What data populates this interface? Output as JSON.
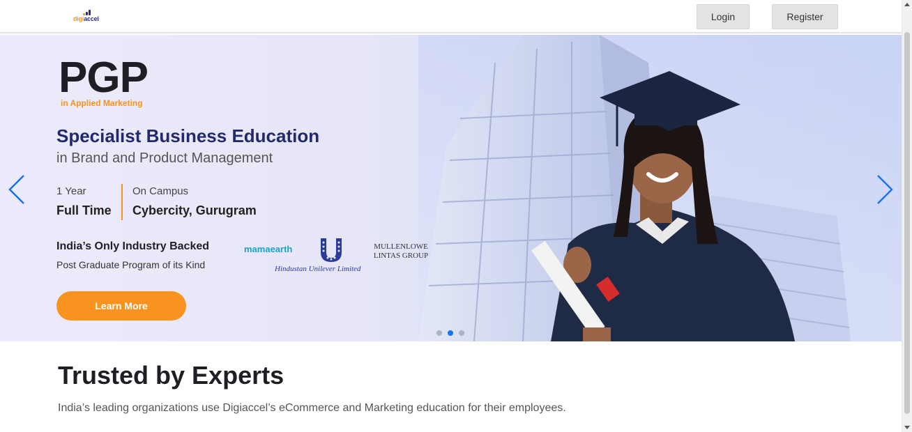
{
  "header": {
    "logo_text_a": "digi",
    "logo_text_b": "accel",
    "login_label": "Login",
    "register_label": "Register"
  },
  "hero": {
    "program": "PGP",
    "program_sub": "in Applied Marketing",
    "headline": "Specialist Business Education",
    "subheadline": "in Brand and Product Management",
    "duration_label": "1 Year",
    "duration_value": "Full Time",
    "location_label": "On Campus",
    "location_value": "Cybercity, Gurugram",
    "backed_title": "India’s Only Industry Backed",
    "backed_sub": "Post Graduate Program of its Kind",
    "brands": {
      "mamaearth": "mamaearth",
      "hul": "Hindustan Unilever Limited",
      "ml_line1": "MULLENLOWE",
      "ml_line2": "LINTAS GROUP"
    },
    "cta_label": "Learn More",
    "carousel": {
      "slides": 3,
      "active": 2
    }
  },
  "trusted": {
    "title": "Trusted by Experts",
    "description": "India’s leading organizations use Digiaccel’s eCommerce and Marketing education for their employees."
  },
  "colors": {
    "brand_orange": "#f7931e",
    "brand_navy": "#232a6b",
    "arrow_blue": "#1a73e8"
  },
  "icons": [
    "chevron-left-icon",
    "chevron-right-icon",
    "unilever-logo-icon"
  ]
}
